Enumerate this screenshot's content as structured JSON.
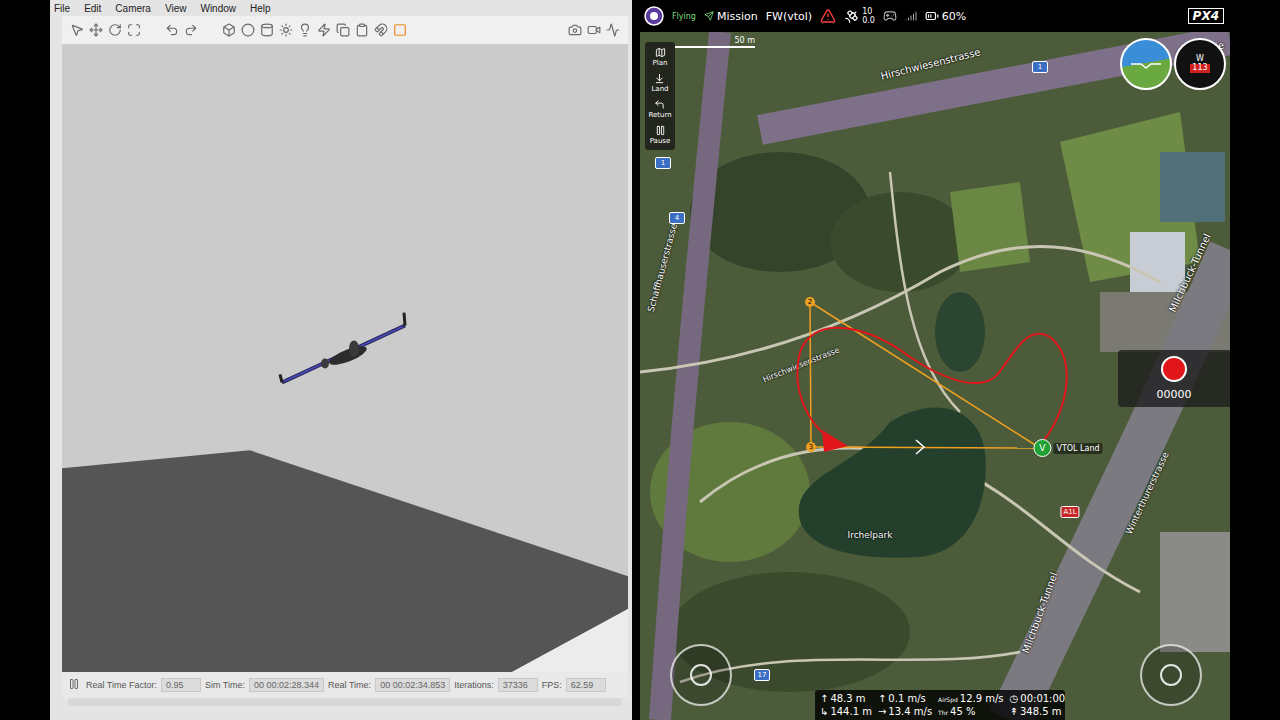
{
  "gazebo": {
    "menu": [
      "File",
      "Edit",
      "Camera",
      "View",
      "Window",
      "Help"
    ],
    "status": [
      {
        "label": "Real Time Factor:",
        "value": "0.95"
      },
      {
        "label": "Sim Time:",
        "value": "00 00:02:28.344"
      },
      {
        "label": "Real Time:",
        "value": "00 00:02:34.853"
      },
      {
        "label": "Iterations:",
        "value": "37336"
      },
      {
        "label": "FPS:",
        "value": "62.59"
      }
    ]
  },
  "qgc": {
    "top_bar": {
      "flight_state": "Flying",
      "flight_mode": "Mission",
      "vehicle": "FW(vtol)",
      "gps_count": "10",
      "gps_hdop": "0.0",
      "battery": "60%",
      "brand": "PX4"
    },
    "toolbar": [
      "Plan",
      "Land",
      "Return",
      "Pause"
    ],
    "scale": "50 m",
    "compass": {
      "heading": "113",
      "cardinal": "W"
    },
    "recorder": {
      "time": "00000"
    },
    "waypoints": [
      {
        "label": "2"
      },
      {
        "label": "3"
      }
    ],
    "landing": {
      "badge": "V",
      "label": "VTOL Land"
    },
    "map_labels": [
      "Hirschwiesenstrasse",
      "Hirschwie",
      "Hirschwiesenstrasse",
      "Schaffhauserstrasse",
      "Irchelpark",
      "Milchbuck-Tunnel",
      "Winterthurerstrasse",
      "Milchbuck-Tunnel"
    ],
    "road_shields": [
      "1",
      "1",
      "4",
      "A1L",
      "17"
    ],
    "telemetry": [
      {
        "prefix": "↑",
        "value": "48.3 m"
      },
      {
        "prefix": "↑",
        "value": "0.1 m/s"
      },
      {
        "prefix": "AirSpd",
        "value": "12.9 m/s"
      },
      {
        "prefix": "◷",
        "value": "00:01:00"
      },
      {
        "prefix": "↳",
        "value": "144.1 m"
      },
      {
        "prefix": "→",
        "value": "13.4 m/s"
      },
      {
        "prefix": "Thr",
        "value": "45 %"
      },
      {
        "prefix": "↟",
        "value": "348.5 m"
      }
    ]
  }
}
